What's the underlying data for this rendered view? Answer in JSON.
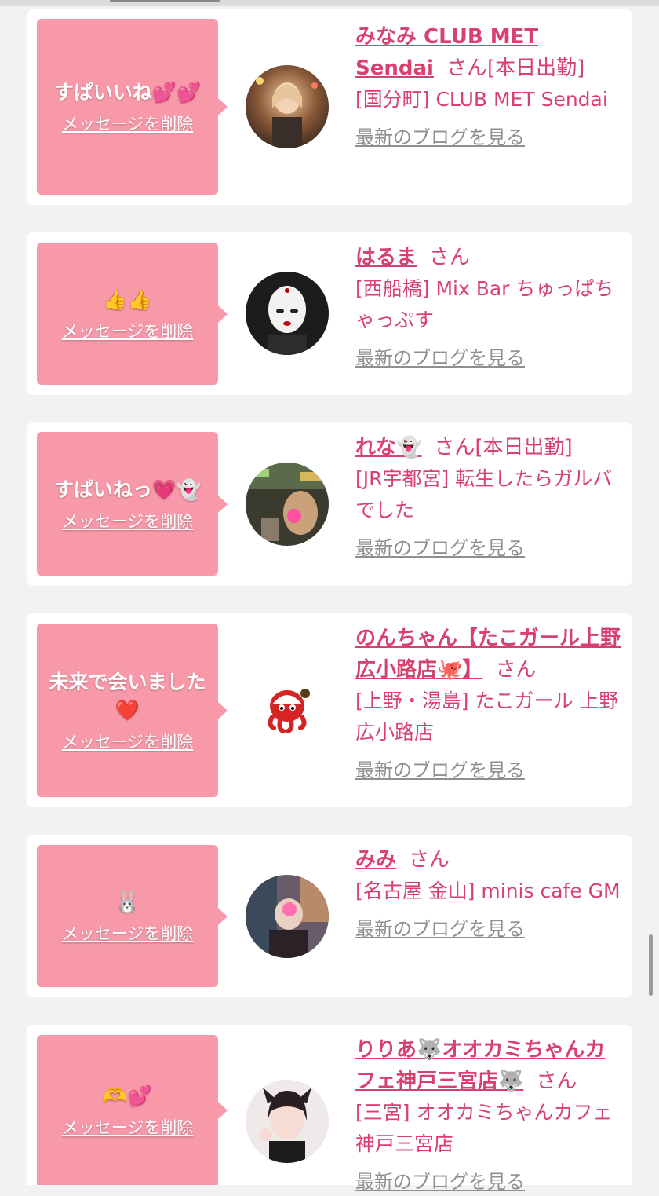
{
  "cards": [
    {
      "message": "すぱいいね💕💕",
      "delete_label": "メッセージを削除",
      "name": "みなみ CLUB MET Sendai",
      "san": "さん",
      "status": "[本日出勤]",
      "shop": "[国分町] CLUB MET Sendai",
      "blog_label": "最新のブログを見る"
    },
    {
      "message": "👍👍",
      "delete_label": "メッセージを削除",
      "name": "はるま",
      "san": "さん",
      "status": "",
      "shop": "[西船橋] Mix Bar ちゅっぱちゃっぷす",
      "blog_label": "最新のブログを見る"
    },
    {
      "message": "すぱいねっ💗👻",
      "delete_label": "メッセージを削除",
      "name": "れな👻",
      "san": "さん",
      "status": "[本日出勤]",
      "shop": "[JR宇都宮] 転生したらガルバでした",
      "blog_label": "最新のブログを見る"
    },
    {
      "message": "未来で会いました❤️",
      "delete_label": "メッセージを削除",
      "name": "のんちゃん【たこガール上野広小路店🐙】",
      "san": "さん",
      "status": "",
      "shop": "[上野・湯島] たこガール 上野広小路店",
      "blog_label": "最新のブログを見る"
    },
    {
      "message": "🐰",
      "delete_label": "メッセージを削除",
      "name": "みみ",
      "san": "さん",
      "status": "",
      "shop": "[名古屋 金山] minis cafe GM",
      "blog_label": "最新のブログを見る"
    },
    {
      "message": "🫶💕",
      "delete_label": "メッセージを削除",
      "name": "りりあ🐺オオカミちゃんカフェ神戸三宮店🐺",
      "san": "さん",
      "status": "",
      "shop": "[三宮] オオカミちゃんカフェ神戸三宮店",
      "blog_label": "最新のブログを見る"
    }
  ],
  "colors": {
    "accent": "#d8416f",
    "message_bg": "#f899a9",
    "page_bg": "#f2f2f2"
  }
}
